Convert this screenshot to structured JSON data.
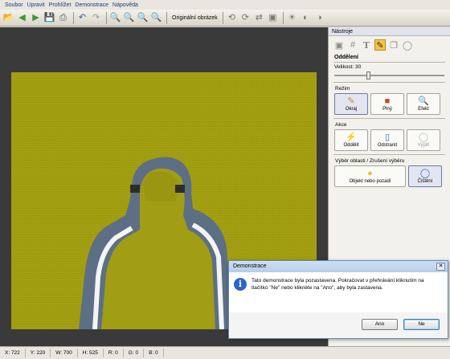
{
  "menu": [
    "Soubor",
    "Upravit",
    "Prohlížet",
    "Demonstrace",
    "Nápověda"
  ],
  "toolbar": {
    "original_label": "Originální obrázek"
  },
  "panel": {
    "title": "Nástroje",
    "section_title": "Oddělení",
    "size_label": "Velikost: 30",
    "size_value": 30,
    "mode": {
      "label": "Režim",
      "buttons": [
        "Okraj",
        "Plný",
        "Efekt"
      ]
    },
    "actions": {
      "label": "Akce",
      "buttons": [
        "Oddělit",
        "Odstranit",
        "Výplň"
      ]
    },
    "selection": {
      "label": "Výběr oblasti / Zrušení výběru",
      "buttons": [
        "Objekt nebo pozadí",
        "Čištění"
      ]
    }
  },
  "status": {
    "x": "X: 722",
    "y": "Y: 220",
    "w": "W: 700",
    "h": "H: 525",
    "r": "R: 0",
    "g": "G: 0",
    "b": "B: 0"
  },
  "dialog": {
    "title": "Demonstrace",
    "message": "Tato demonstrace byla pozastavena. Pokračovat v přehrávání kliknutím na tlačítko \"Ne\" nebo klikněte na \"Ano\", aby byla zastavena.",
    "yes": "Ano",
    "no": "Ne"
  },
  "colors": {
    "image_tint": "#a39f12",
    "workspace": "#3a3a3a"
  }
}
